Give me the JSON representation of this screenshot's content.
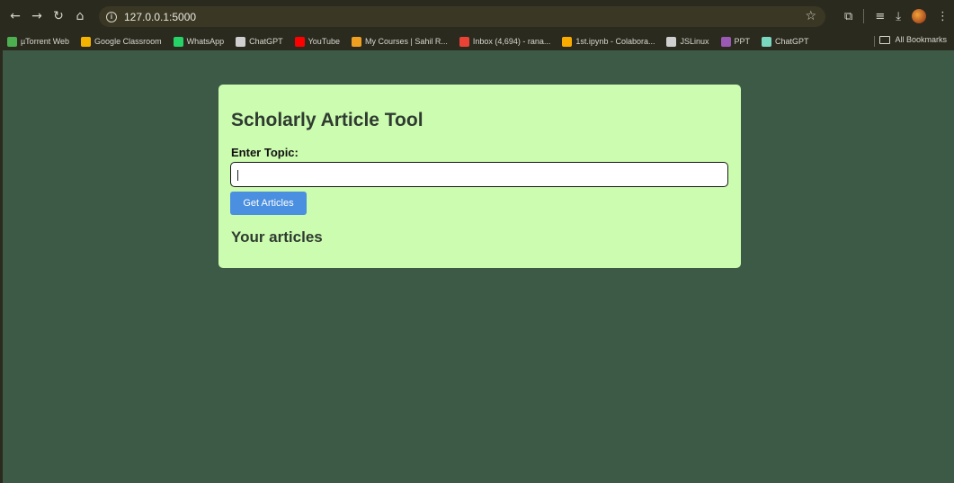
{
  "browser": {
    "url": "127.0.0.1:5000",
    "bookmarks": [
      {
        "label": "µTorrent Web",
        "color": "#4caf50"
      },
      {
        "label": "Google Classroom",
        "color": "#f4b400"
      },
      {
        "label": "WhatsApp",
        "color": "#25d366"
      },
      {
        "label": "ChatGPT",
        "color": "#cfcfcf"
      },
      {
        "label": "YouTube",
        "color": "#ff0000"
      },
      {
        "label": "My Courses | Sahil R...",
        "color": "#f0a020"
      },
      {
        "label": "Inbox (4,694) - rana...",
        "color": "#ea4335"
      },
      {
        "label": "1st.ipynb - Colabora...",
        "color": "#f9ab00"
      },
      {
        "label": "JSLinux",
        "color": "#cfcfcf"
      },
      {
        "label": "PPT",
        "color": "#9b59b6"
      },
      {
        "label": "ChatGPT",
        "color": "#7ad7c0"
      }
    ],
    "all_bookmarks_label": "All Bookmarks"
  },
  "page": {
    "title": "Scholarly Article Tool",
    "topic_label": "Enter Topic:",
    "topic_value": "",
    "button_label": "Get Articles",
    "results_heading": "Your articles"
  },
  "colors": {
    "page_background": "#3d5a46",
    "card_background": "#ccfcb0",
    "button": "#4a8fe0"
  }
}
